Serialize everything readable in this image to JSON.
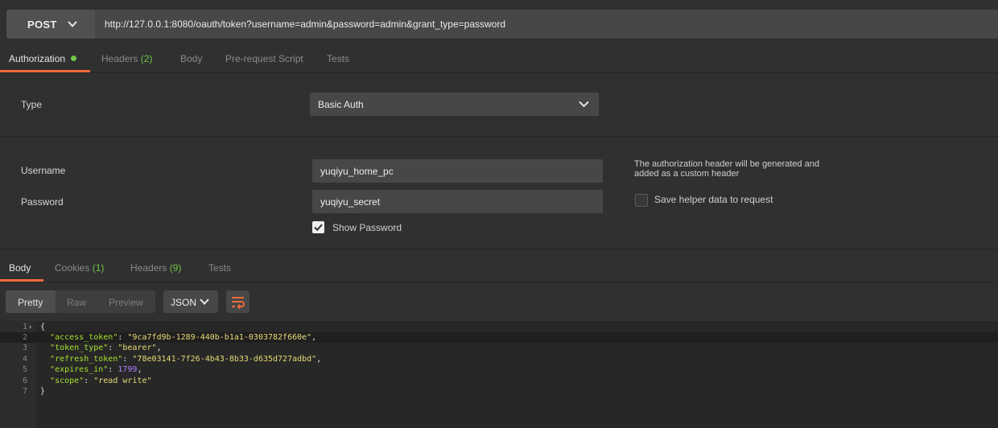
{
  "request": {
    "method": "POST",
    "url": "http://127.0.0.1:8080/oauth/token?username=admin&password=admin&grant_type=password"
  },
  "request_tabs": [
    {
      "label": "Authorization",
      "count": "",
      "active": true,
      "indicator": "green-dot"
    },
    {
      "label": "Headers",
      "count": "(2)",
      "active": false
    },
    {
      "label": "Body",
      "count": "",
      "active": false
    },
    {
      "label": "Pre-request Script",
      "count": "",
      "active": false
    },
    {
      "label": "Tests",
      "count": "",
      "active": false
    }
  ],
  "auth": {
    "type_label": "Type",
    "type_value": "Basic Auth",
    "username_label": "Username",
    "username_value": "yuqiyu_home_pc",
    "password_label": "Password",
    "password_value": "yuqiyu_secret",
    "show_password_label": "Show Password",
    "show_password_checked": true,
    "note": "The authorization header will be generated and added as a custom header",
    "helper_label": "Save helper data to request",
    "helper_checked": false
  },
  "response_tabs": [
    {
      "label": "Body",
      "count": "",
      "active": true
    },
    {
      "label": "Cookies",
      "count": "(1)",
      "active": false
    },
    {
      "label": "Headers",
      "count": "(9)",
      "active": false
    },
    {
      "label": "Tests",
      "count": "",
      "active": false
    }
  ],
  "view": {
    "modes": [
      "Pretty",
      "Raw",
      "Preview"
    ],
    "active_mode": "Pretty",
    "format": "JSON"
  },
  "code": {
    "line_numbers": [
      "1",
      "2",
      "3",
      "4",
      "5",
      "6",
      "7"
    ],
    "open_brace": "{",
    "close_brace": "}",
    "entries": [
      {
        "key": "\"access_token\"",
        "value": "\"9ca7fd9b-1289-440b-b1a1-0303782f660e\"",
        "value_type": "string",
        "comma": ","
      },
      {
        "key": "\"token_type\"",
        "value": "\"bearer\"",
        "value_type": "string",
        "comma": ","
      },
      {
        "key": "\"refresh_token\"",
        "value": "\"78e03141-7f26-4b43-8b33-d635d727adbd\"",
        "value_type": "string",
        "comma": ","
      },
      {
        "key": "\"expires_in\"",
        "value": "1799",
        "value_type": "number",
        "comma": ","
      },
      {
        "key": "\"scope\"",
        "value": "\"read write\"",
        "value_type": "string",
        "comma": ""
      }
    ]
  },
  "colors": {
    "accent": "#f26b3a",
    "count_green": "#71c544",
    "json_key": "#a6e22e",
    "json_string": "#e6db74",
    "json_number": "#ae81ff"
  }
}
